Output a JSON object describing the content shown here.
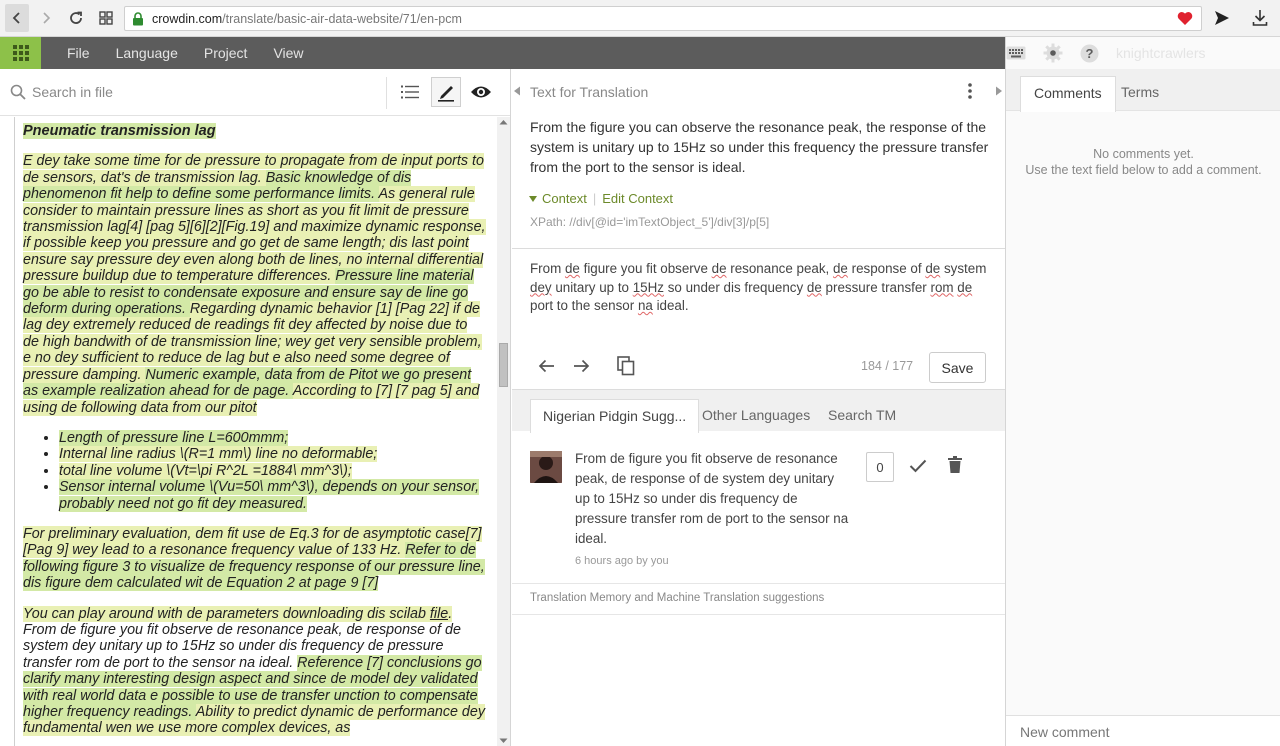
{
  "browser": {
    "url_host": "crowdin.com",
    "url_path": "/translate/basic-air-data-website/71/en-pcm"
  },
  "menu": {
    "items": [
      "File",
      "Language",
      "Project",
      "View"
    ],
    "username": "knightcrawlers"
  },
  "search": {
    "placeholder": "Search in file"
  },
  "document": {
    "heading": "Pneumatic transmission lag",
    "p1_a": "E dey take some time for de pressure to propagate from de input ports to de sensors,  dat's de transmission lag. ",
    "p1_b": "Basic knowledge of dis phenomenon fit help to define some performance limits. ",
    "p1_c": "As general rule consider to maintain pressure lines as short as you fit limit de pressure transmission lag[4] [pag 5][6][2][Fig.19] and maximize dynamic response, if possible keep you pressure and go get de same length; dis last point ensure say pressure dey even along both de lines, no internal differential pressure buildup due to temperature differences. ",
    "p1_d": "Pressure line material go be able to resist to condensate exposure and ensure say de line go deform during operations. ",
    "p1_e": "Regarding dynamic behavior [1] [Pag 22] if de lag dey extremely reduced de readings fit dey affected by noise due to de high bandwith of de transmission line; wey get very sensible problem, e no dey sufficient to reduce de lag but e also need some degree of pressure damping. ",
    "p1_f": "Numeric example, data from de Pitot we go present as example realization ahead for de page. ",
    "p1_g": "According to [7] [7 pag 5] and using de following data from our pitot",
    "bullets": [
      "Length of pressure line L=600mmm;",
      "Internal line radius \\(R=1 mm\\) line no deformable;",
      "total line volume \\(Vt=\\pi R^2L =1884\\ mm^3\\);",
      "Sensor internal volume \\(Vu=50\\ mm^3\\), depends on your sensor, probably need not go fit dey measured."
    ],
    "p2_a": "For preliminary evaluation, dem fit use de Eq.3 for de asymptotic case[7] [Pag 9] wey lead to a resonance frequency value of 133 Hz. ",
    "p2_b": "Refer to de following figure 3 to visualize de frequency response of our pressure line, dis figure dem calculated wit de Equation 2 at page 9 [7]",
    "p3_a": "You can play around with de parameters downloading dis scilab ",
    "p3_link": "file",
    "p3_b": ". ",
    "p3_c": "From de figure you fit observe de resonance peak, de response of de system dey unitary up to 15Hz so under dis frequency de pressure transfer rom de port to the sensor na ideal. ",
    "p3_d": "Reference [7] conclusions go clarify many interesting design aspect and since de model dey validated with real world data e possible to use de transfer unction to compensate higher frequency readings. ",
    "p3_e": "Ability to predict dynamic de performance dey fundamental wen we use more complex devices, as"
  },
  "editor": {
    "section_title": "Text for Translation",
    "source_text": "From the figure you can observe the resonance peak, the response of the system is unitary up to 15Hz so under this frequency the pressure transfer from the port to the sensor is ideal.",
    "context_label": "Context",
    "edit_context_label": "Edit Context",
    "xpath": "XPath: //div[@id='imTextObject_5']/div[3]/p[5]",
    "target": {
      "t1": "From ",
      "t2": "de",
      "t3": " figure you fit observe ",
      "t4": "de",
      "t5": " resonance peak, ",
      "t6": "de",
      "t7": " response of ",
      "t8": "de",
      "t9": " system ",
      "t10": "dey",
      "t11": " unitary up to ",
      "t12": "15Hz",
      "t13": " so under dis frequency ",
      "t14": "de",
      "t15": " pressure transfer ",
      "t16": "rom",
      "t17": " ",
      "t18": "de",
      "t19": " port to the sensor ",
      "t20": "na",
      "t21": " ideal."
    },
    "counter": "184 / 177",
    "save_label": "Save"
  },
  "suggestions": {
    "tabs": [
      "Nigerian Pidgin Sugg...",
      "Other Languages",
      "Search TM"
    ],
    "items": [
      {
        "text": "From de figure you fit observe de resonance peak, de response of de system dey unitary up to 15Hz so under dis frequency de pressure transfer rom de port to the sensor na ideal.",
        "meta": "6 hours ago by you",
        "votes": "0"
      }
    ],
    "tm_label": "Translation Memory and Machine Translation suggestions"
  },
  "side": {
    "tabs": [
      "Comments",
      "Terms"
    ],
    "no_comments_1": "No comments yet.",
    "no_comments_2": "Use the text field below to add a comment.",
    "new_comment_placeholder": "New comment"
  },
  "colors": {
    "accent_green": "#8dc149",
    "menubar": "#5c5c5c",
    "highlight": "#e9f0b4",
    "highlight_strong": "#d3e9a6",
    "heart": "#e0222f"
  }
}
